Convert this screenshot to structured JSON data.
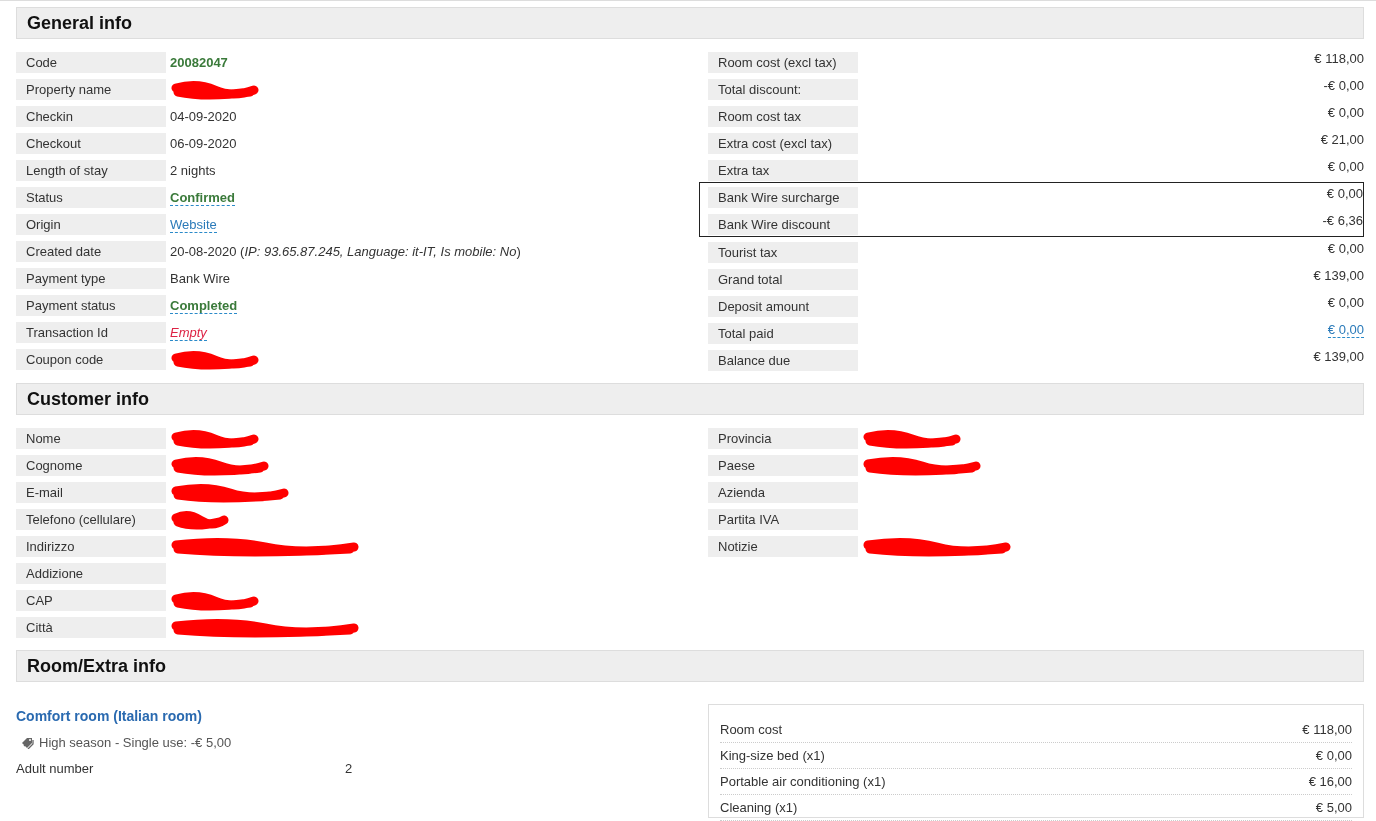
{
  "sections": [
    {
      "title": "General info",
      "left": [
        {
          "label": "Code",
          "value": "20082047",
          "kind": "code"
        },
        {
          "label": "Property name",
          "kind": "redacted"
        },
        {
          "label": "Checkin",
          "value": "04-09-2020",
          "kind": "plain"
        },
        {
          "label": "Checkout",
          "value": "06-09-2020",
          "kind": "plain"
        },
        {
          "label": "Length of stay",
          "value": "2 nights",
          "kind": "plain"
        },
        {
          "label": "Status",
          "value": "Confirmed",
          "kind": "ok"
        },
        {
          "label": "Origin",
          "value": "Website",
          "kind": "link"
        },
        {
          "label": "Created date",
          "value": "20-08-2020 (*IP: 93.65.87.245, Language: it-IT, Is mobile: No*)",
          "kind": "plain"
        },
        {
          "label": "Payment type",
          "value": "Bank Wire",
          "kind": "plain"
        },
        {
          "label": "Payment status",
          "value": "Completed",
          "kind": "ok"
        },
        {
          "label": "Transaction Id",
          "value": "Empty",
          "kind": "empty"
        },
        {
          "label": "Coupon code",
          "kind": "redacted"
        }
      ],
      "right": [
        {
          "label": "Room cost (excl tax)",
          "value": "€ 118,00",
          "kind": "amount",
          "highlighted": false
        },
        {
          "label": "Total discount:",
          "value": "-€ 0,00",
          "kind": "amount",
          "highlighted": false
        },
        {
          "label": "Room cost tax",
          "value": "€ 0,00",
          "kind": "amount",
          "highlighted": false
        },
        {
          "label": "Extra cost (excl tax)",
          "value": "€ 21,00",
          "kind": "amount",
          "highlighted": false
        },
        {
          "label": "Extra tax",
          "value": "€ 0,00",
          "kind": "amount",
          "highlighted": false
        },
        {
          "label": "Bank Wire surcharge",
          "value": "€ 0,00",
          "kind": "amount",
          "highlighted": true
        },
        {
          "label": "Bank Wire discount",
          "value": "-€ 6,36",
          "kind": "amount",
          "highlighted": true
        },
        {
          "label": "Tourist tax",
          "value": "€ 0,00",
          "kind": "amount",
          "highlighted": false
        },
        {
          "label": "Grand total",
          "value": "€ 139,00",
          "kind": "amount",
          "highlighted": false
        },
        {
          "label": "Deposit amount",
          "value": "€ 0,00",
          "kind": "amount",
          "highlighted": false
        },
        {
          "label": "Total paid",
          "value": "€ 0,00",
          "kind": "amountlink",
          "highlighted": false
        },
        {
          "label": "Balance due",
          "value": "€ 139,00",
          "kind": "amount",
          "highlighted": false
        }
      ]
    },
    {
      "title": "Customer info",
      "left": [
        {
          "label": "Nome",
          "kind": "redacted"
        },
        {
          "label": "Cognome",
          "kind": "redacted"
        },
        {
          "label": "E-mail",
          "kind": "redacted"
        },
        {
          "label": "Telefono (cellulare)",
          "kind": "redacted"
        },
        {
          "label": "Indirizzo",
          "kind": "redacted"
        },
        {
          "label": "Addizione",
          "kind": "blank"
        },
        {
          "label": "CAP",
          "kind": "redacted"
        },
        {
          "label": "Città",
          "kind": "redacted"
        }
      ],
      "right": [
        {
          "label": "Provincia",
          "kind": "redacted"
        },
        {
          "label": "Paese",
          "kind": "redacted"
        },
        {
          "label": "Azienda",
          "kind": "blank"
        },
        {
          "label": "Partita IVA",
          "kind": "blank"
        },
        {
          "label": "Notizie",
          "kind": "redacted"
        }
      ]
    },
    {
      "title": "Room/Extra info",
      "room": {
        "name": "Comfort room (Italian room)",
        "rate": "High season - Single use: -€ 5,00",
        "details": [
          {
            "label": "Adult number",
            "value": "2"
          }
        ],
        "costs": [
          {
            "label": "Room cost",
            "value": "€ 118,00"
          },
          {
            "label": "King-size bed (x1)",
            "value": "€ 0,00"
          },
          {
            "label": "Portable air conditioning (x1)",
            "value": "€ 16,00"
          },
          {
            "label": "Cleaning (x1)",
            "value": "€ 5,00"
          }
        ]
      }
    }
  ]
}
